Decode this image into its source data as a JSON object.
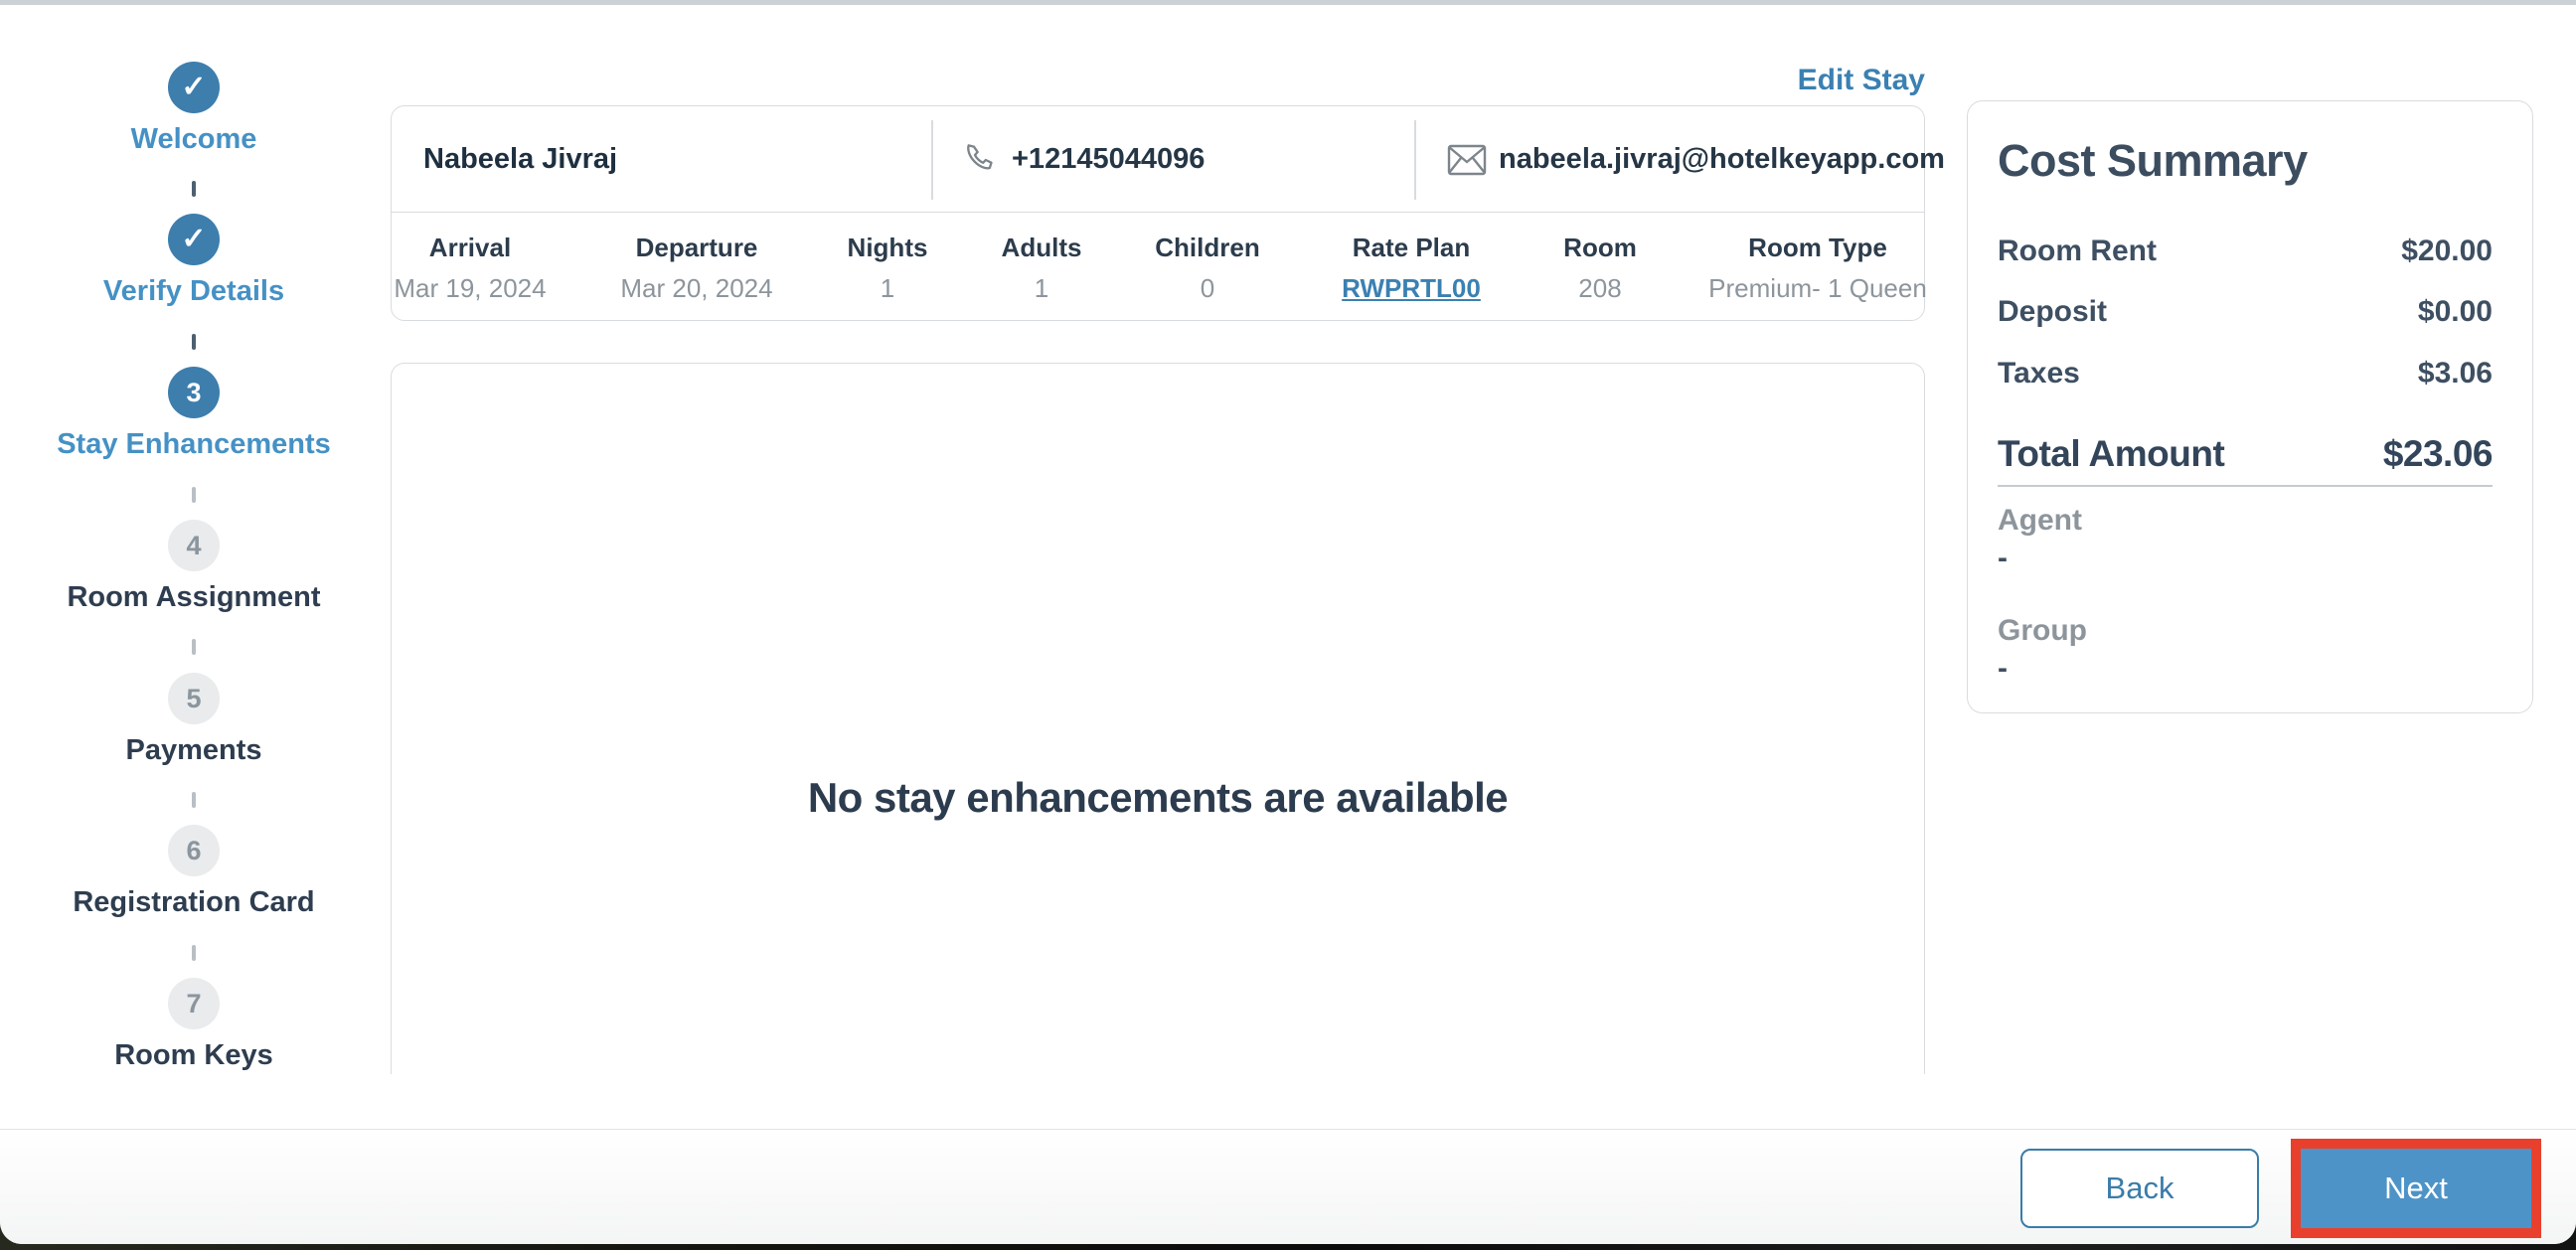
{
  "header": {
    "edit_stay_label": "Edit Stay"
  },
  "stepper": {
    "steps": [
      {
        "label": "Welcome",
        "state": "done",
        "icon": "check-icon"
      },
      {
        "label": "Verify Details",
        "state": "done",
        "icon": "check-icon"
      },
      {
        "label": "Stay Enhancements",
        "state": "active",
        "number": "3"
      },
      {
        "label": "Room Assignment",
        "state": "pending",
        "number": "4"
      },
      {
        "label": "Payments",
        "state": "pending",
        "number": "5"
      },
      {
        "label": "Registration Card",
        "state": "pending",
        "number": "6"
      },
      {
        "label": "Room Keys",
        "state": "pending",
        "number": "7"
      }
    ],
    "check_glyph": "✓"
  },
  "guest": {
    "name": "Nabeela Jivraj",
    "phone": "+12145044096",
    "email": "nabeela.jivraj@hotelkeyapp.com"
  },
  "stay": {
    "columns": [
      {
        "label": "Arrival",
        "value": "Mar 19, 2024"
      },
      {
        "label": "Departure",
        "value": "Mar 20, 2024"
      },
      {
        "label": "Nights",
        "value": "1"
      },
      {
        "label": "Adults",
        "value": "1"
      },
      {
        "label": "Children",
        "value": "0"
      },
      {
        "label": "Rate Plan",
        "value": "RWPRTL00"
      },
      {
        "label": "Room",
        "value": "208"
      },
      {
        "label": "Room Type",
        "value": "Premium- 1 Queen"
      }
    ]
  },
  "enhancements": {
    "empty_message": "No stay enhancements are available"
  },
  "cost_summary": {
    "title": "Cost Summary",
    "rows": [
      {
        "label": "Room Rent",
        "value": "$20.00"
      },
      {
        "label": "Deposit",
        "value": "$0.00"
      },
      {
        "label": "Taxes",
        "value": "$3.06"
      }
    ],
    "total": {
      "label": "Total Amount",
      "value": "$23.06"
    },
    "agent": {
      "label": "Agent",
      "value": "-"
    },
    "group": {
      "label": "Group",
      "value": "-"
    }
  },
  "footer": {
    "back_label": "Back",
    "next_label": "Next"
  },
  "colors": {
    "accent_blue": "#4591c5",
    "circle_blue": "#3d7ead",
    "next_button_blue": "#4e93c8",
    "highlight_red": "#e8402c",
    "dark_text": "#2e3d4f",
    "muted_text": "#8d959c",
    "border": "#d9dcdf"
  }
}
